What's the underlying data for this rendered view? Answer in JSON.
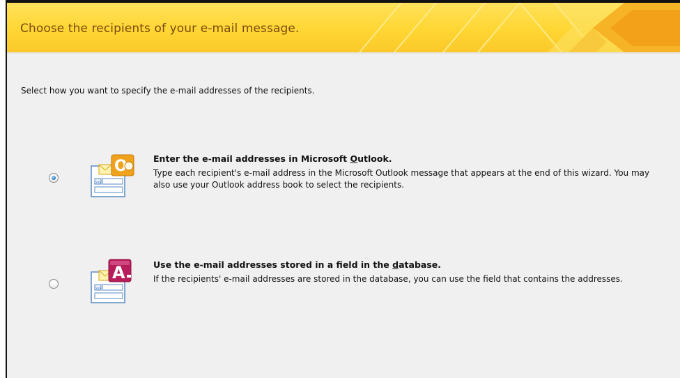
{
  "wizard": {
    "title": "Choose the recipients of your e-mail message.",
    "instruction": "Select how you want to specify the e-mail addresses of the recipients."
  },
  "options": [
    {
      "title_before": "Enter the e-mail addresses in Microsoft ",
      "title_accel": "O",
      "title_after": "utlook.",
      "description": "Type each recipient's e-mail address in the Microsoft Outlook message that appears at the end of this wizard. You may also use your Outlook address book to select the recipients.",
      "selected": true,
      "icon": "outlook-icon",
      "icon_letter": "O"
    },
    {
      "title_before": "Use the e-mail addresses stored in a field in the ",
      "title_accel": "d",
      "title_after": "atabase.",
      "description": "If the recipients' e-mail addresses are stored in the database, you can use the field that contains the addresses.",
      "selected": false,
      "icon": "access-icon",
      "icon_letter": "A"
    }
  ],
  "colors": {
    "header_bg": "#ffd633",
    "header_text": "#7a4a12",
    "outlook": "#f0a21c",
    "access": "#b81d5b"
  }
}
